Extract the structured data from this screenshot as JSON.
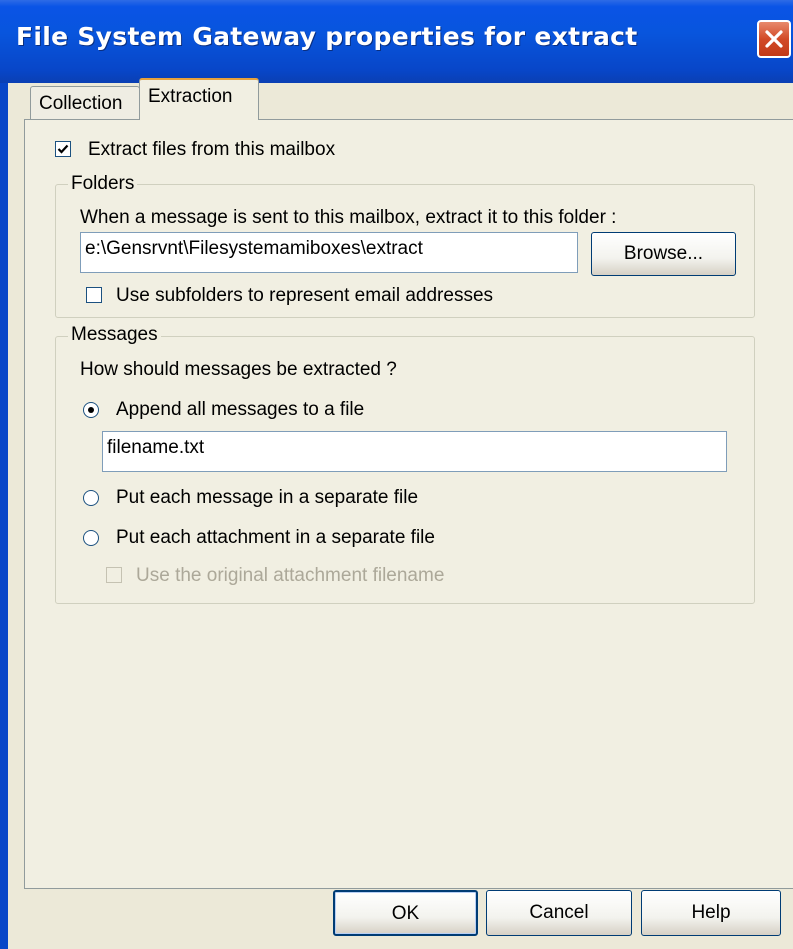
{
  "window": {
    "title": "File System Gateway properties for extract"
  },
  "tabs": [
    {
      "label": "Collection",
      "active": false
    },
    {
      "label": "Extraction",
      "active": true
    }
  ],
  "extract_checkbox": {
    "label": "Extract files from this mailbox",
    "checked": true
  },
  "folders": {
    "group_label": "Folders",
    "instruction": "When a message is sent to this mailbox, extract it to this folder :",
    "path_value": "e:\\Gensrvnt\\Filesystemamiboxes\\extract",
    "browse_label": "Browse...",
    "subfolders_checkbox": {
      "label": "Use subfolders to represent email addresses",
      "checked": false
    }
  },
  "messages": {
    "group_label": "Messages",
    "question": "How should messages be extracted ?",
    "options": [
      {
        "label": "Append all messages to a file",
        "selected": true
      },
      {
        "label": "Put each message in a separate file",
        "selected": false
      },
      {
        "label": "Put each attachment in a separate file",
        "selected": false
      }
    ],
    "filename_value": "filename.txt",
    "original_filename_checkbox": {
      "label": "Use the original attachment filename",
      "checked": false,
      "enabled": false
    }
  },
  "buttons": {
    "ok": "OK",
    "cancel": "Cancel",
    "help": "Help"
  },
  "colors": {
    "titlebar": "#0A54E6",
    "dialog_bg": "#ECE9D8",
    "close_button": "#D24A27"
  }
}
